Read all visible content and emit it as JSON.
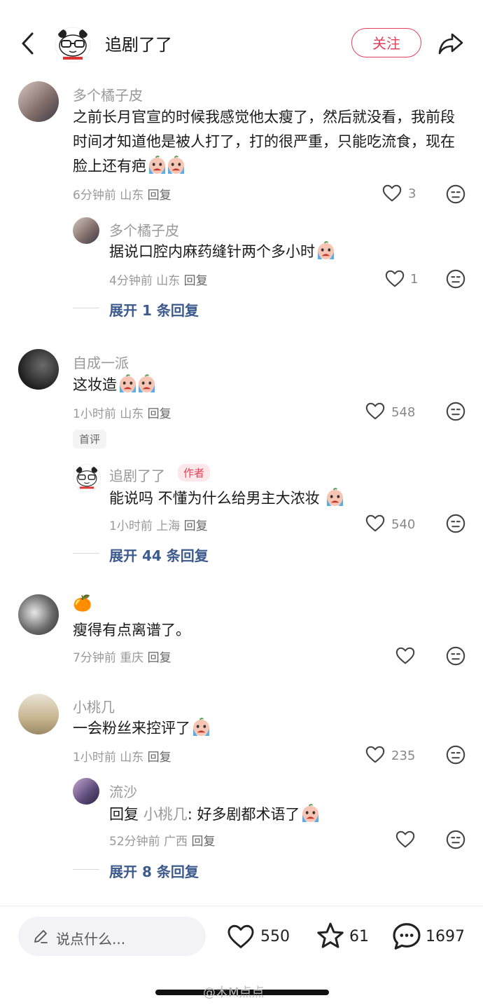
{
  "header": {
    "back_icon": "chevron-left-icon",
    "title": "追剧了了",
    "follow_label": "关注",
    "share_icon": "share-arrow-icon"
  },
  "comments": [
    {
      "name": "多个橘子皮",
      "text": "之前长月官宣的时候我感觉他太瘦了，然后就没看，我前段时间才知道他是被人打了，打的很严重，只能吃流食，现在脸上还有疤",
      "time": "6分钟前",
      "location": "山东",
      "reply_label": "回复",
      "likes": "3",
      "replies": [
        {
          "name": "多个橘子皮",
          "text": "据说口腔内麻药缝针两个多小时",
          "time": "4分钟前",
          "location": "山东",
          "reply_label": "回复",
          "likes": "1"
        }
      ],
      "expand": "展开 1 条回复"
    },
    {
      "name": "自成一派",
      "text": "这妆造",
      "time": "1小时前",
      "location": "山东",
      "reply_label": "回复",
      "likes": "548",
      "badge": "首评",
      "replies": [
        {
          "name": "追剧了了",
          "author_tag": "作者",
          "text": "能说吗  不懂为什么给男主大浓妆",
          "time": "1小时前",
          "location": "上海",
          "reply_label": "回复",
          "likes": "540"
        }
      ],
      "expand": "展开 44 条回复"
    },
    {
      "name": "🍊",
      "text": "瘦得有点离谱了。",
      "time": "7分钟前",
      "location": "重庆",
      "reply_label": "回复",
      "likes": ""
    },
    {
      "name": "小桃几",
      "text": "一会粉丝来控评了",
      "time": "1小时前",
      "location": "山东",
      "reply_label": "回复",
      "likes": "235",
      "replies": [
        {
          "name": "流沙",
          "text_prefix": "回复",
          "quote_name": "小桃几",
          "text": ": 好多剧都术语了",
          "time": "52分钟前",
          "location": "广西",
          "reply_label": "回复",
          "likes": ""
        }
      ],
      "expand": "展开 8 条回复"
    }
  ],
  "bottom_bar": {
    "placeholder": "说点什么...",
    "likes": "550",
    "favorites": "61",
    "comments": "1697"
  },
  "watermark": "@木M点点",
  "colors": {
    "accent": "#e3405a",
    "expand_link": "#3c5a8c",
    "muted_text": "#999999"
  }
}
